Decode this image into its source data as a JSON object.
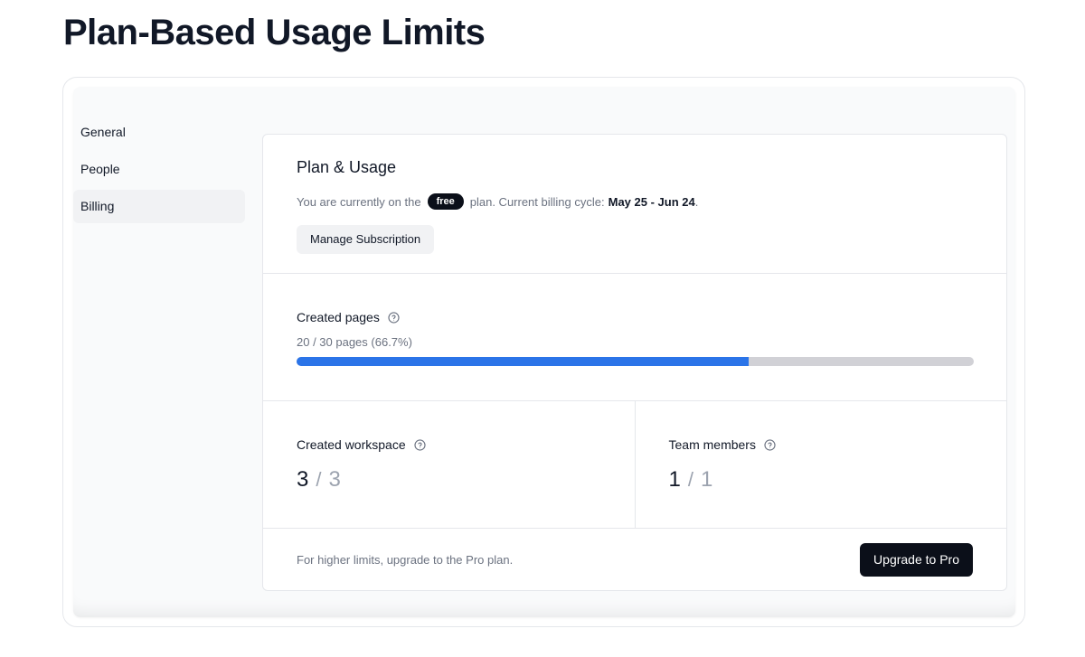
{
  "page": {
    "title": "Plan-Based Usage Limits"
  },
  "sidebar": {
    "items": [
      {
        "label": "General",
        "active": false
      },
      {
        "label": "People",
        "active": false
      },
      {
        "label": "Billing",
        "active": true
      }
    ]
  },
  "plan": {
    "title": "Plan & Usage",
    "prefix": "You are currently on the",
    "plan_badge": "free",
    "cycle_prefix": "plan. Current billing cycle:",
    "cycle": "May 25 - Jun 24",
    "cycle_suffix": ".",
    "manage_button": "Manage Subscription"
  },
  "pages_usage": {
    "label": "Created pages",
    "summary": "20 / 30 pages (66.7%)",
    "used": 20,
    "limit": 30,
    "percent": 66.7
  },
  "workspace_usage": {
    "label": "Created workspace",
    "used": "3",
    "slash": "/",
    "limit": "3"
  },
  "members_usage": {
    "label": "Team members",
    "used": "1",
    "slash": "/",
    "limit": "1"
  },
  "footer": {
    "text": "For higher limits, upgrade to the Pro plan.",
    "upgrade_button": "Upgrade to Pro"
  },
  "colors": {
    "progress_fill": "#2b74e8",
    "progress_track": "#d1d1d6",
    "badge_bg": "#0b0f19",
    "primary_button": "#0b0f19"
  },
  "icons": {
    "help": "question-circle-icon"
  }
}
